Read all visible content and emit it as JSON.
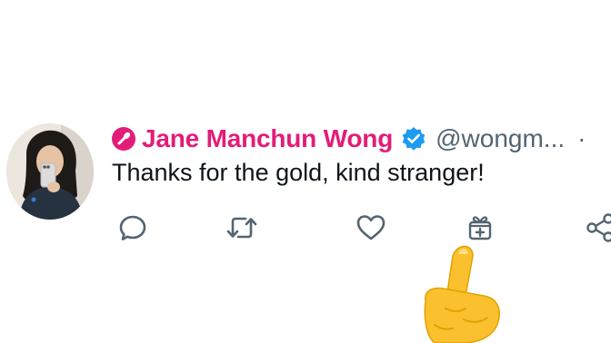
{
  "tweet": {
    "author": {
      "display_name": "Jane Manchun Wong",
      "handle": "@wongm...",
      "separator": "·",
      "name_color": "#e31c79",
      "badge_icon": "pin-badge-icon",
      "verified_icon": "verified-badge-icon",
      "verified_color": "#1d9bf0"
    },
    "text": "Thanks for the gold, kind stranger!",
    "actions": [
      {
        "name": "reply",
        "icon": "reply-icon"
      },
      {
        "name": "retweet",
        "icon": "retweet-icon"
      },
      {
        "name": "like",
        "icon": "heart-icon"
      },
      {
        "name": "gift",
        "icon": "gift-icon"
      },
      {
        "name": "share",
        "icon": "share-icon"
      }
    ],
    "overlay_icon": "pointing-hand-icon"
  },
  "colors": {
    "text": "#0f1419",
    "secondary": "#536471",
    "background": "#ffffff"
  }
}
